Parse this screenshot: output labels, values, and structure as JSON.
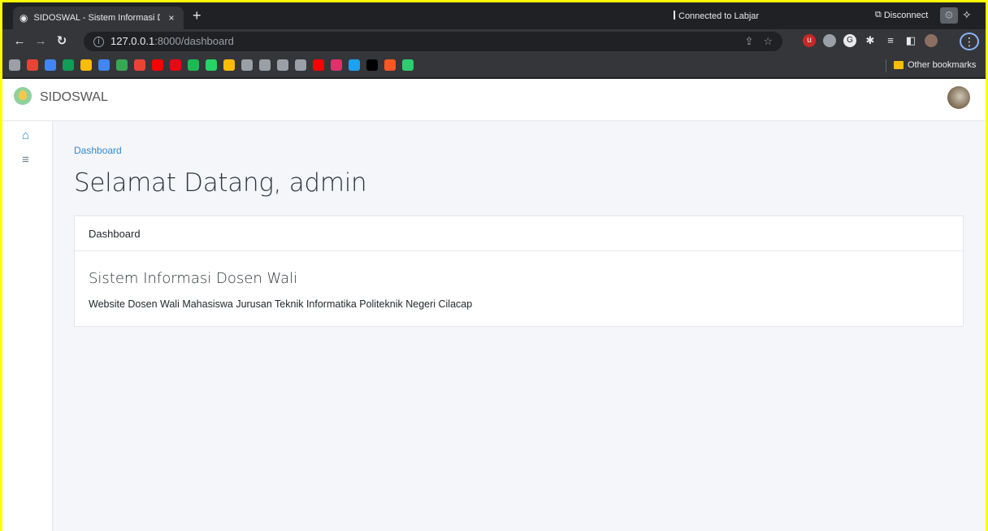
{
  "browser": {
    "tab_title": "SIDOSWAL - Sistem Informasi Do",
    "tab_close": "×",
    "new_tab": "+",
    "remote_status": "Connected to Labjar",
    "disconnect_label": "Disconnect",
    "url_host": "127.0.0.1",
    "url_rest": ":8000/dashboard",
    "other_bookmarks": "Other bookmarks",
    "bookmark_colors": [
      "#9aa0a6",
      "#ea4335",
      "#4285f4",
      "#0f9d58",
      "#fbbc04",
      "#4285f4",
      "#34a853",
      "#ea4335",
      "#ff0000",
      "#e50914",
      "#1db954",
      "#25d366",
      "#fbbc04",
      "#9aa0a6",
      "#9aa0a6",
      "#9aa0a6",
      "#9aa0a6",
      "#ff0000",
      "#e1306c",
      "#1da1f2",
      "#000000",
      "#ff5722",
      "#2ecc71"
    ]
  },
  "app": {
    "brand": "SIDOSWAL",
    "breadcrumb": "Dashboard",
    "heading": "Selamat Datang, admin",
    "card": {
      "header": "Dashboard",
      "title": "Sistem Informasi Dosen Wali",
      "text": "Website Dosen Wali Mahasiswa Jurusan Teknik Informatika Politeknik Negeri Cilacap"
    }
  },
  "colors": {
    "accent": "#2f8cd6",
    "frame_border": "#ffff00",
    "content_bg": "#f4f6f9"
  }
}
